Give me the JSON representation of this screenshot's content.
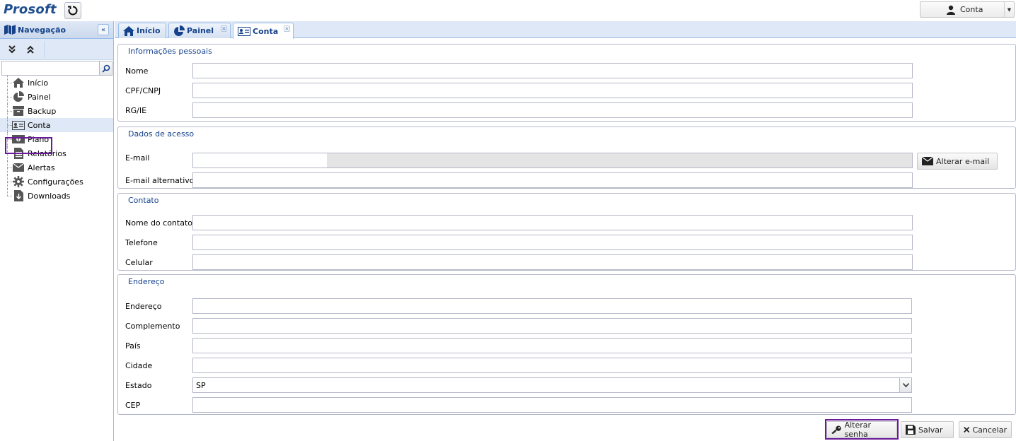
{
  "app": {
    "logo": "Prosoft"
  },
  "header": {
    "account_label": "Conta"
  },
  "sidebar": {
    "title": "Navegação",
    "search_placeholder": "",
    "items": [
      {
        "label": "Início",
        "icon": "home-icon"
      },
      {
        "label": "Painel",
        "icon": "pie-chart-icon"
      },
      {
        "label": "Backup",
        "icon": "archive-box-icon"
      },
      {
        "label": "Conta",
        "icon": "id-card-icon",
        "selected": true
      },
      {
        "label": "Plano",
        "icon": "money-icon"
      },
      {
        "label": "Relatórios",
        "icon": "document-icon"
      },
      {
        "label": "Alertas",
        "icon": "envelope-icon"
      },
      {
        "label": "Configurações",
        "icon": "gear-icon"
      },
      {
        "label": "Downloads",
        "icon": "download-icon"
      }
    ]
  },
  "tabs": [
    {
      "label": "Início",
      "icon": "home-icon",
      "closable": false
    },
    {
      "label": "Painel",
      "icon": "pie-chart-icon",
      "closable": true
    },
    {
      "label": "Conta",
      "icon": "id-card-icon",
      "closable": true,
      "active": true
    }
  ],
  "form": {
    "personal": {
      "legend": "Informações pessoais",
      "nome_label": "Nome",
      "nome_value": "",
      "cpf_label": "CPF/CNPJ",
      "cpf_value": "",
      "rg_label": "RG/IE",
      "rg_value": ""
    },
    "access": {
      "legend": "Dados de acesso",
      "email_label": "E-mail",
      "email_value": "",
      "change_email_button": "Alterar e-mail",
      "alt_email_label": "E-mail alternativo",
      "alt_email_value": ""
    },
    "contact": {
      "legend": "Contato",
      "contact_name_label": "Nome do contato",
      "contact_name_value": "",
      "phone_label": "Telefone",
      "phone_value": "",
      "mobile_label": "Celular",
      "mobile_value": ""
    },
    "address": {
      "legend": "Endereço",
      "address_label": "Endereço",
      "address_value": "",
      "complement_label": "Complemento",
      "complement_value": "",
      "country_label": "País",
      "country_value": "",
      "city_label": "Cidade",
      "city_value": "",
      "state_label": "Estado",
      "state_value": "SP",
      "cep_label": "CEP",
      "cep_value": ""
    }
  },
  "actions": {
    "change_password": "Alterar senha",
    "save": "Salvar",
    "cancel": "Cancelar"
  },
  "colors": {
    "accent": "#15428b",
    "highlight": "#6a1b9a",
    "panel_header": "#dfe8f6"
  }
}
